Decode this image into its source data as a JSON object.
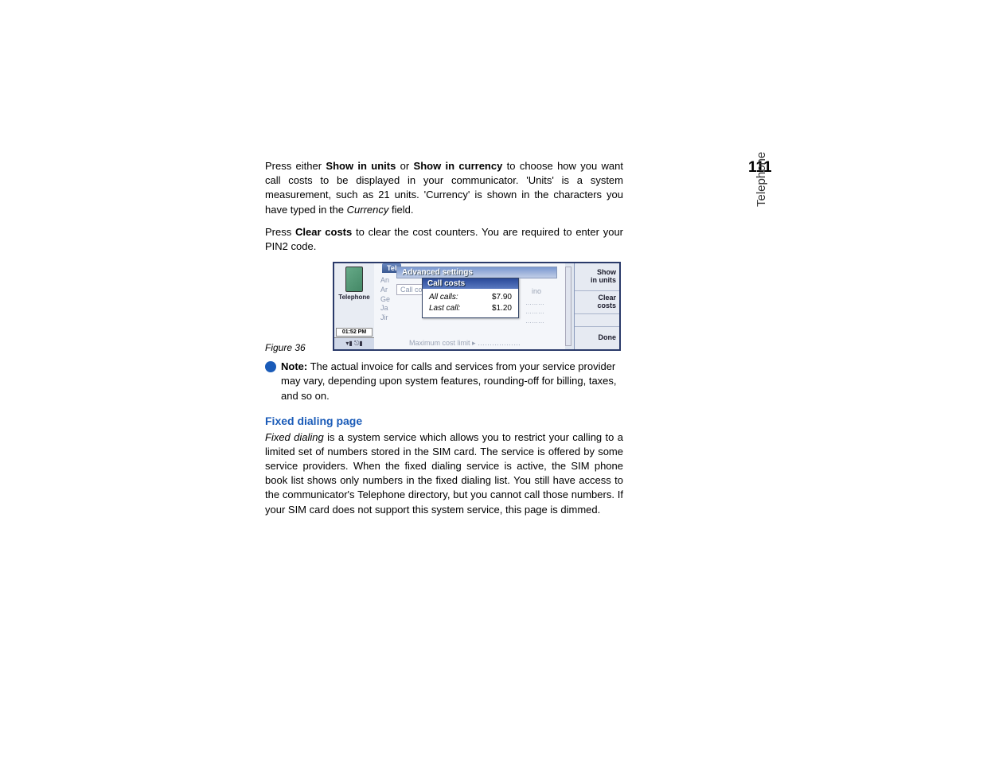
{
  "page_number": "111",
  "side_label": "Telephone",
  "para1": {
    "pre": "Press either ",
    "b1": "Show in units",
    "mid1": " or ",
    "b2": "Show in currency",
    "post1": " to choose how you want call costs to be displayed in your communicator. 'Units' is a system measurement, such as 21 units. 'Currency' is shown in the characters you have typed in the ",
    "i1": "Currency",
    "post2": " field."
  },
  "para2": {
    "pre": "Press ",
    "b1": "Clear costs",
    "post": " to clear the cost counters. You are required to enter your PIN2 code."
  },
  "figure_caption": "Figure 36",
  "device": {
    "left_label": "Telephone",
    "time": "01:52 PM",
    "status_icons": "▾▮ ⎋▮",
    "tab": "Tel",
    "list_items": [
      "An",
      "Ar",
      "Ge",
      "Ja",
      "Jir"
    ],
    "call_co": "Call co",
    "adv_title": "Advanced settings",
    "dialog_title": "Call costs",
    "row1_label": "All calls:",
    "row1_value": "$7.90",
    "row2_label": "Last call:",
    "row2_value": "$1.20",
    "max_line": "Maximum cost limit ▸ ………………",
    "uno": "ino",
    "dots": "………\n………\n………",
    "softkeys": {
      "k1a": "Show",
      "k1b": "in units",
      "k2": "Clear costs",
      "k3": "Done"
    }
  },
  "note": {
    "label": "Note:",
    "text": " The actual invoice for calls and services from your service provider may vary, depending upon system features, rounding-off for billing, taxes, and so on."
  },
  "heading": "Fixed dialing page",
  "para3": {
    "i1": "Fixed dialing",
    "post": " is a system service which allows you to restrict your calling to a limited set of numbers stored in the SIM card. The service is offered by some service providers. When the fixed dialing service is active, the SIM phone book list shows only numbers in the fixed dialing list. You still have access to the communicator's Telephone directory, but you cannot call those numbers. If your SIM card does not support this system service, this page is dimmed."
  }
}
